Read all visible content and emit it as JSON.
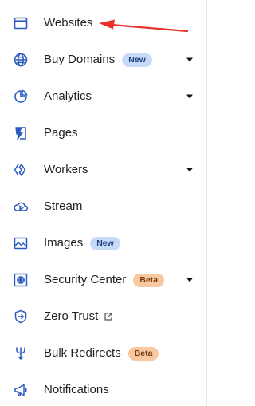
{
  "sidebar": {
    "items": [
      {
        "label": "Websites",
        "icon": "browser-window-icon"
      },
      {
        "label": "Buy Domains",
        "icon": "globe-icon",
        "badge": "New",
        "has_chevron": true
      },
      {
        "label": "Analytics",
        "icon": "pie-chart-icon",
        "has_chevron": true
      },
      {
        "label": "Pages",
        "icon": "lightning-page-icon"
      },
      {
        "label": "Workers",
        "icon": "workers-icon",
        "has_chevron": true
      },
      {
        "label": "Stream",
        "icon": "cloud-play-icon"
      },
      {
        "label": "Images",
        "icon": "image-icon",
        "badge": "New"
      },
      {
        "label": "Security Center",
        "icon": "security-center-icon",
        "badge": "Beta",
        "has_chevron": true
      },
      {
        "label": "Zero Trust",
        "icon": "shield-arrow-icon",
        "external": true
      },
      {
        "label": "Bulk Redirects",
        "icon": "redirect-fork-icon",
        "badge": "Beta"
      },
      {
        "label": "Notifications",
        "icon": "megaphone-icon"
      }
    ]
  },
  "colors": {
    "icon_blue": "#2c5bbf",
    "badge_new_bg": "#c7dbf8",
    "badge_beta_bg": "#f8c9a0",
    "annotation_arrow": "#e8322b"
  }
}
